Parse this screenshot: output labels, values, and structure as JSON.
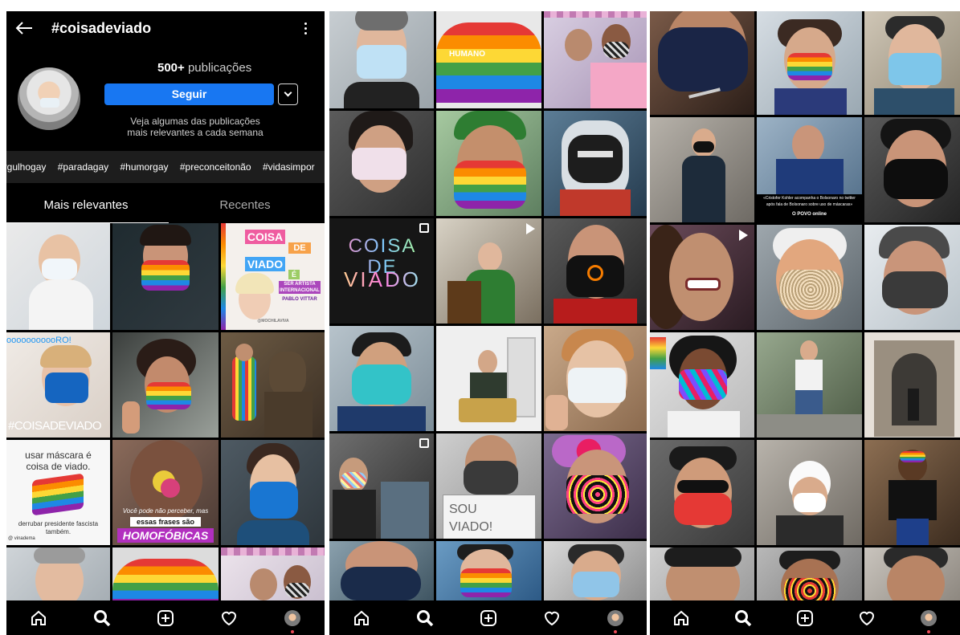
{
  "header": {
    "title": "#coisadeviado",
    "back_icon": "back-arrow-icon",
    "more_icon": "more-vertical-icon"
  },
  "profile": {
    "posts_count": "500+",
    "posts_label": "publicações",
    "follow_label": "Seguir",
    "dropdown_icon": "chevron-down-icon",
    "note": "Veja algumas das publicações mais relevantes a cada semana"
  },
  "related_hashtags": [
    "orgulhogay",
    "#paradagay",
    "#humorgay",
    "#preconceitonão",
    "#vidasimpor"
  ],
  "tabs": [
    {
      "label": "Mais relevantes",
      "active": true
    },
    {
      "label": "Recentes",
      "active": false
    }
  ],
  "panel1_posts": {
    "post_3_text": [
      "COISA",
      "DE",
      "VIADO",
      "É",
      "SER ARTISTA INTERNACIONAL",
      "PABLO VITTAR",
      "@MOCHILAVIVA"
    ],
    "post_4_text": "ooooooooooRO!",
    "post_4_hashtag": "#COISADEVIADO",
    "post_7_text": [
      "usar máscara é",
      "coisa de viado.",
      "derrubar presidente fascista",
      "também.",
      "@ vinadema"
    ],
    "post_8_text": [
      "Você pode não perceber, mas",
      "essas frases são",
      "HOMOFÓBICAS"
    ]
  },
  "panel2_posts": {
    "post_2_text": "HUMANO",
    "post_7_text": [
      "COISA DE",
      "VIADO"
    ],
    "post_14_text": [
      "SOU",
      "VIADO!"
    ]
  },
  "panel3_posts": {
    "post_5_text": [
      "«Cristofer Kohler acompanha o Bolsonaro no twitter",
      "após fala de Bolsonaro sobre uso de máscaras»",
      "O POVO online"
    ]
  },
  "bottom_nav": [
    "home-icon",
    "search-icon",
    "add-post-icon",
    "heart-icon",
    "profile-avatar"
  ]
}
